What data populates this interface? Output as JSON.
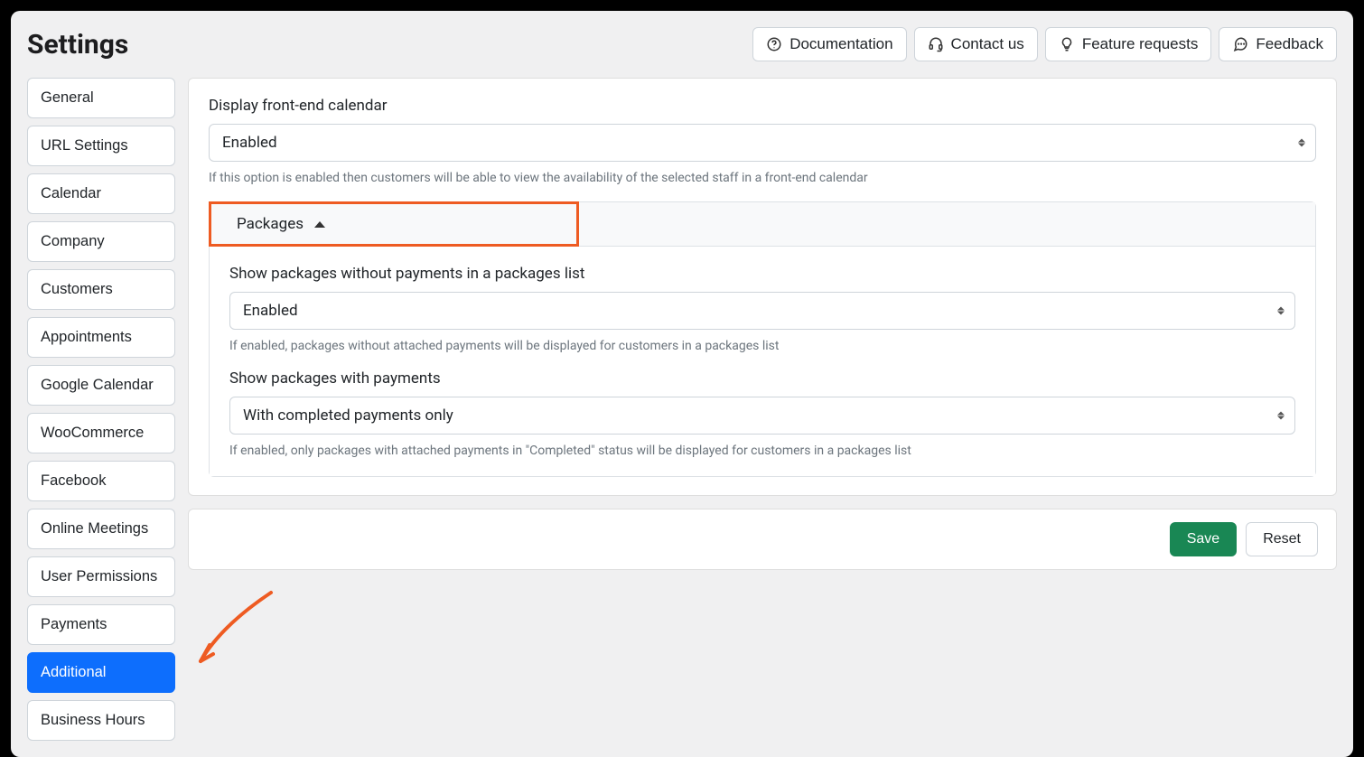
{
  "header": {
    "title": "Settings",
    "buttons": {
      "documentation": "Documentation",
      "contact": "Contact us",
      "feature": "Feature requests",
      "feedback": "Feedback"
    }
  },
  "sidebar": {
    "items": [
      {
        "key": "general",
        "label": "General",
        "active": false
      },
      {
        "key": "url-settings",
        "label": "URL Settings",
        "active": false
      },
      {
        "key": "calendar",
        "label": "Calendar",
        "active": false
      },
      {
        "key": "company",
        "label": "Company",
        "active": false
      },
      {
        "key": "customers",
        "label": "Customers",
        "active": false
      },
      {
        "key": "appointments",
        "label": "Appointments",
        "active": false
      },
      {
        "key": "google-calendar",
        "label": "Google Calendar",
        "active": false
      },
      {
        "key": "woocommerce",
        "label": "WooCommerce",
        "active": false
      },
      {
        "key": "facebook",
        "label": "Facebook",
        "active": false
      },
      {
        "key": "online-meetings",
        "label": "Online Meetings",
        "active": false
      },
      {
        "key": "user-permissions",
        "label": "User Permissions",
        "active": false
      },
      {
        "key": "payments",
        "label": "Payments",
        "active": false
      },
      {
        "key": "additional",
        "label": "Additional",
        "active": true
      },
      {
        "key": "business-hours",
        "label": "Business Hours",
        "active": false
      }
    ]
  },
  "main": {
    "field1": {
      "label": "Display front-end calendar",
      "value": "Enabled",
      "help": "If this option is enabled then customers will be able to view the availability of the selected staff in a front-end calendar"
    },
    "accordion": {
      "title": "Packages",
      "field1": {
        "label": "Show packages without payments in a packages list",
        "value": "Enabled",
        "help": "If enabled, packages without attached payments will be displayed for customers in a packages list"
      },
      "field2": {
        "label": "Show packages with payments",
        "value": "With completed payments only",
        "help": "If enabled, only packages with attached payments in \"Completed\" status will be displayed for customers in a packages list"
      }
    }
  },
  "footer": {
    "save": "Save",
    "reset": "Reset"
  }
}
